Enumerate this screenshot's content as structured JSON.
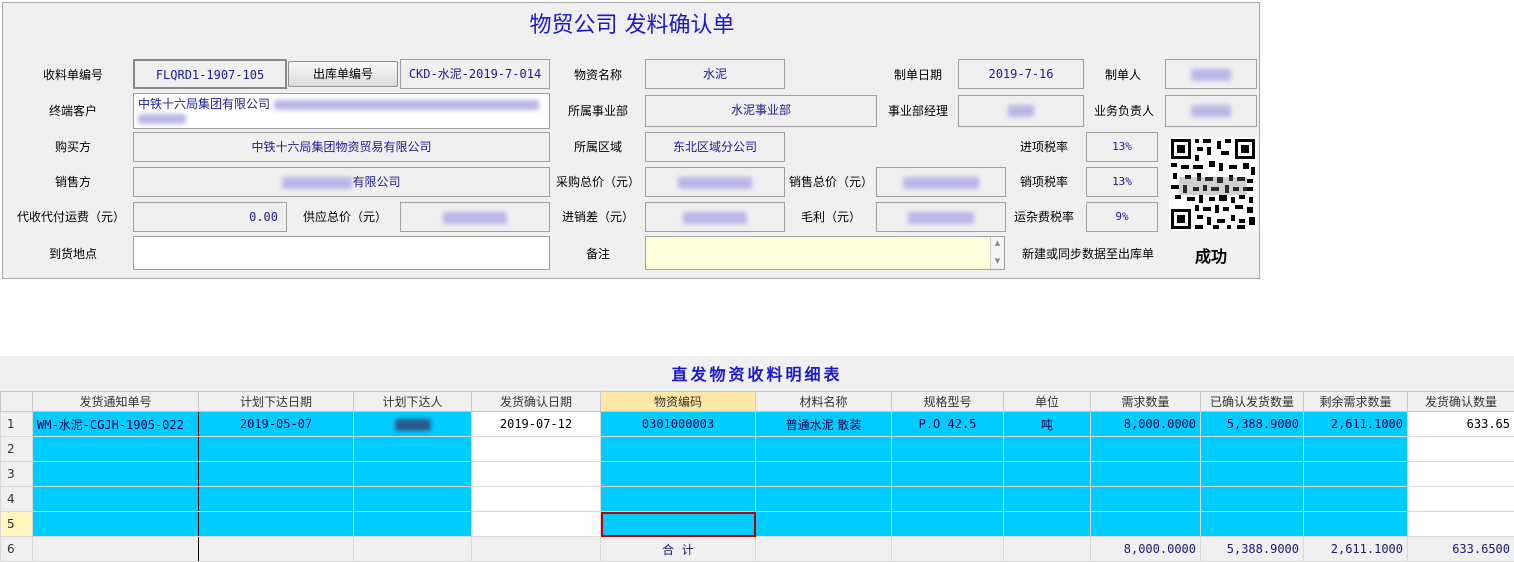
{
  "form": {
    "title": "物贸公司 发料确认单",
    "receipt_no_label": "收料单编号",
    "receipt_no": "FLQRD1-1907-105",
    "outbound_btn": "出库单编号",
    "outbound_no": "CKD-水泥-2019-7-014",
    "material_name_label": "物资名称",
    "material_name": "水泥",
    "made_date_label": "制单日期",
    "made_date": "2019-7-16",
    "maker_label": "制单人",
    "end_customer_label": "终端客户",
    "end_customer": "中铁十六局集团有限公司",
    "division_label": "所属事业部",
    "division": "水泥事业部",
    "division_mgr_label": "事业部经理",
    "biz_owner_label": "业务负责人",
    "buyer_label": "购买方",
    "buyer": "中铁十六局集团物资贸易有限公司",
    "region_label": "所属区域",
    "region": "东北区域分公司",
    "input_tax_label": "进项税率",
    "input_tax": "13%",
    "seller_label": "销售方",
    "seller_suffix": "有限公司",
    "purchase_total_label": "采购总价（元）",
    "sales_total_label": "销售总价（元）",
    "output_tax_label": "销项税率",
    "output_tax": "13%",
    "freight_label": "代收代付运费（元）",
    "freight": "0.00",
    "supply_total_label": "供应总价（元）",
    "diff_label": "进销差（元）",
    "gross_label": "毛利（元）",
    "misc_tax_label": "运杂费税率",
    "misc_tax": "9%",
    "delivery_label": "到货地点",
    "remark_label": "备注",
    "sync_label": "新建或同步数据至出库单",
    "sync_status": "成功"
  },
  "table": {
    "title": "直发物资收料明细表",
    "headers": [
      "发货通知单号",
      "计划下达日期",
      "计划下达人",
      "发货确认日期",
      "物资编码",
      "材料名称",
      "规格型号",
      "单位",
      "需求数量",
      "已确认发货数量",
      "剩余需求数量",
      "发货确认数量"
    ],
    "row_numbers": [
      "1",
      "2",
      "3",
      "4",
      "5",
      "6"
    ],
    "row1": {
      "notice_no": "WM-水泥-CGJH-1905-022",
      "plan_date": "2019-05-07",
      "confirm_date": "2019-07-12",
      "code": "0301000003",
      "material": "普通水泥 散装",
      "spec": "P.O 42.5",
      "unit": "吨",
      "demand": "8,000.0000",
      "confirmed": "5,388.9000",
      "remaining": "2,611.1000",
      "ship_qty": "633.65"
    },
    "total": {
      "label": "合  计",
      "demand": "8,000.0000",
      "confirmed": "5,388.9000",
      "remaining": "2,611.1000",
      "ship_qty": "633.6500"
    }
  },
  "colors": {
    "title_blue": "#1a1acc",
    "row_cyan": "#00ccff",
    "remark_yellow": "#ffffdd",
    "focus_red": "#c00000"
  }
}
